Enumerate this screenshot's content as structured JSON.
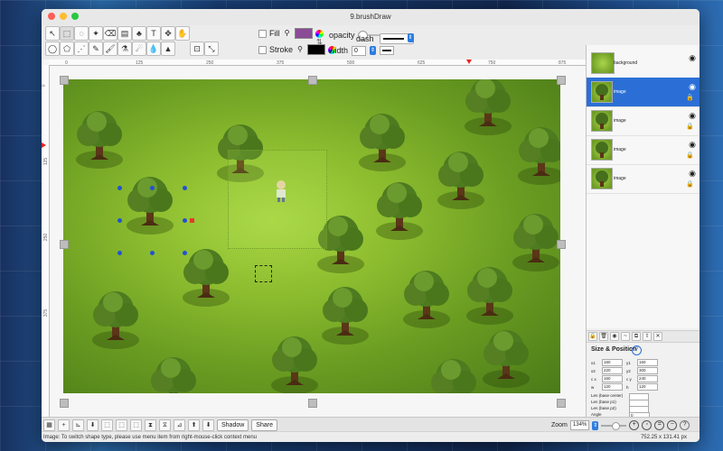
{
  "window": {
    "title": "9.brushDraw"
  },
  "toolbar": {
    "fill_label": "Fill",
    "stroke_label": "Stroke",
    "fill_color": "#8a4c96",
    "stroke_color": "#000000",
    "opacity_label": "opacity",
    "width_label": "width",
    "width_value": "0",
    "dash_label": "dash",
    "tools": [
      {
        "name": "arrow-tool",
        "glyph": "↖"
      },
      {
        "name": "rect-select-tool",
        "glyph": "⬚"
      },
      {
        "name": "ellipse-select-tool",
        "glyph": "◌"
      },
      {
        "name": "magic-wand-tool",
        "glyph": "✦"
      },
      {
        "name": "eraser-tool",
        "glyph": "⌫"
      },
      {
        "name": "gradient-tool",
        "glyph": "▤"
      },
      {
        "name": "stamp-tool",
        "glyph": "♣"
      },
      {
        "name": "text-tool",
        "glyph": "T"
      },
      {
        "name": "move-tool",
        "glyph": "✥"
      },
      {
        "name": "hand-tool",
        "glyph": "✋"
      },
      {
        "name": "spacer",
        "glyph": ""
      },
      {
        "name": "spacer",
        "glyph": ""
      },
      {
        "name": "lasso-tool",
        "glyph": "◯"
      },
      {
        "name": "polygon-lasso-tool",
        "glyph": "⬠"
      },
      {
        "name": "wand2-tool",
        "glyph": "⋰"
      },
      {
        "name": "pencil-tool",
        "glyph": "✎"
      },
      {
        "name": "brush-tool",
        "glyph": "🖌"
      },
      {
        "name": "eyedropper-tool",
        "glyph": "⚗"
      },
      {
        "name": "smudge-tool",
        "glyph": "☄"
      },
      {
        "name": "drop-tool",
        "glyph": "💧"
      },
      {
        "name": "cone-tool",
        "glyph": "▲"
      },
      {
        "name": "spacer",
        "glyph": ""
      },
      {
        "name": "crop-tool",
        "glyph": "⊡"
      },
      {
        "name": "resize-tool",
        "glyph": "⤡"
      }
    ]
  },
  "ruler": {
    "h_ticks": [
      "0",
      "125",
      "250",
      "375",
      "500",
      "625",
      "750",
      "875"
    ],
    "v_ticks": [
      "0",
      "125",
      "250",
      "375"
    ]
  },
  "bottombar": {
    "shadow_label": "Shadow",
    "share_label": "Share",
    "zoom_label": "Zoom",
    "zoom_value": "134%",
    "help": "?"
  },
  "status": {
    "message": "Image: To switch shape type, please use menu item from right-mouse-click context menu",
    "coords": "752.25 x 131.41 px"
  },
  "layers": [
    {
      "name": "background",
      "selected": false
    },
    {
      "name": "image",
      "selected": true
    },
    {
      "name": "image",
      "selected": false
    },
    {
      "name": "image",
      "selected": false
    },
    {
      "name": "image",
      "selected": false
    }
  ],
  "size_position": {
    "title": "Size & Position",
    "help": "?",
    "rows": [
      [
        {
          "label": "x1",
          "value": "160"
        },
        {
          "label": "y1",
          "value": "160"
        }
      ],
      [
        {
          "label": "x2",
          "value": "220"
        },
        {
          "label": "y2",
          "value": "300"
        }
      ],
      [
        {
          "label": "c x",
          "value": "160"
        },
        {
          "label": "c y",
          "value": "240"
        }
      ],
      [
        {
          "label": "w",
          "value": "120"
        },
        {
          "label": "h",
          "value": "120"
        }
      ]
    ],
    "len_labels": [
      "Len (base center)",
      "Len (base p1)",
      "Len (base p2)"
    ],
    "angle_label": "Angle",
    "angle_value": "0"
  },
  "colors": {
    "accent": "#2b6fd6",
    "grass": "#8dbd2f"
  }
}
